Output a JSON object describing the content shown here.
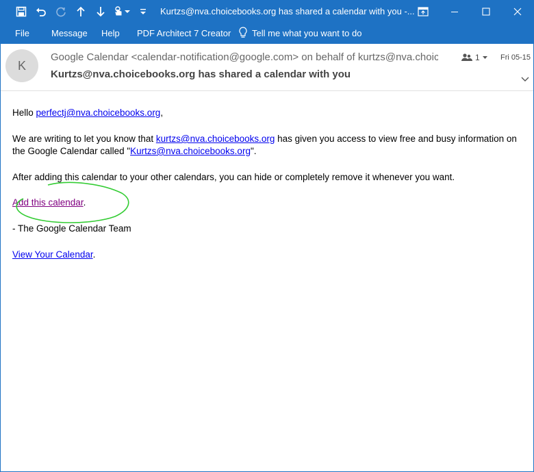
{
  "titlebar": {
    "title": "Kurtzs@nva.choicebooks.org has shared a calendar with you  -...",
    "icons": [
      "save-icon",
      "undo-icon",
      "redo-icon",
      "up-arrow-icon",
      "down-arrow-icon",
      "touch-mode-icon",
      "customize-toolbar-icon"
    ],
    "window_buttons": [
      "restore-ribbon-icon",
      "minimize-icon",
      "maximize-icon",
      "close-icon"
    ]
  },
  "ribbon": {
    "file": "File",
    "message": "Message",
    "help": "Help",
    "pdf": "PDF Architect 7 Creator",
    "tell_me": "Tell me what you want to do"
  },
  "header": {
    "avatar_initial": "K",
    "from": "Google Calendar <calendar-notification@google.com> on behalf of kurtzs@nva.choicebooks.org",
    "subject": "Kurtzs@nva.choicebooks.org has shared a calendar with you",
    "people_count": "1",
    "date": "Fri 05-15"
  },
  "body": {
    "hello": "Hello ",
    "hello_link": "perfectj@nva.choicebooks.org",
    "hello_end": ",",
    "p2_start": "We are writing to let you know that ",
    "p2_link1": "kurtzs@nva.choicebooks.org",
    "p2_mid": " has given you access to view free and busy information on the Google Calendar called \"",
    "p2_link2": "Kurtzs@nva.choicebooks.org",
    "p2_end": "\".",
    "p3": "After adding this calendar to your other calendars, you can hide or completely remove it whenever you want.",
    "add_link": "Add this calendar",
    "add_end": ".",
    "team": "- The Google Calendar Team",
    "view_link": "View Your Calendar",
    "view_end": "."
  },
  "colors": {
    "accent": "#1e72c4",
    "link": "#0000ee",
    "visited_link": "#800080",
    "annotation": "#33cc33"
  }
}
